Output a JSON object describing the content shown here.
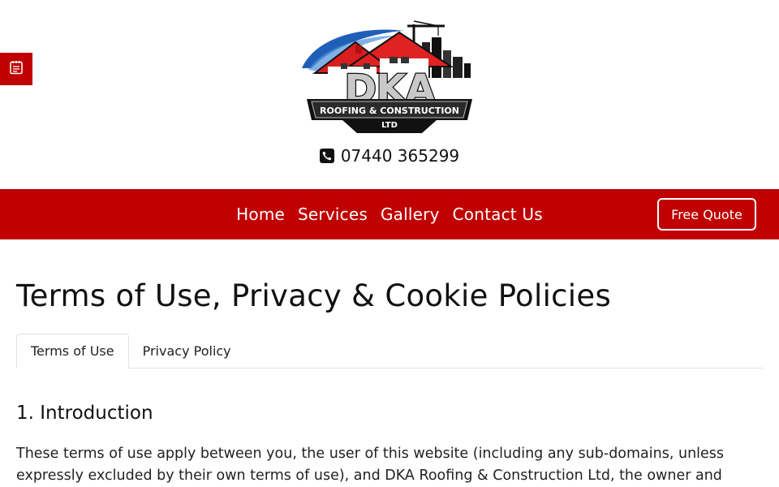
{
  "header": {
    "logo": {
      "brand": "DKA",
      "line1": "ROOFING & CONSTRUCTION",
      "line2": "LTD"
    },
    "phone": "07440 365299"
  },
  "side_tab": {
    "icon": "notepad-icon"
  },
  "nav": {
    "links": [
      "Home",
      "Services",
      "Gallery",
      "Contact Us"
    ],
    "quote_button": "Free Quote"
  },
  "page": {
    "title": "Terms of Use, Privacy & Cookie Policies",
    "tabs": [
      {
        "label": "Terms of Use",
        "active": true
      },
      {
        "label": "Privacy Policy",
        "active": false
      }
    ],
    "section_heading": "1. Introduction",
    "body_text": "These terms of use apply between you, the user of this website (including any sub-domains, unless expressly excluded by their own terms of use), and DKA Roofing & Construction Ltd, the owner and"
  },
  "colors": {
    "brand_red": "#c00000",
    "text": "#1a1a1a",
    "tab_border": "#dee2e6"
  }
}
